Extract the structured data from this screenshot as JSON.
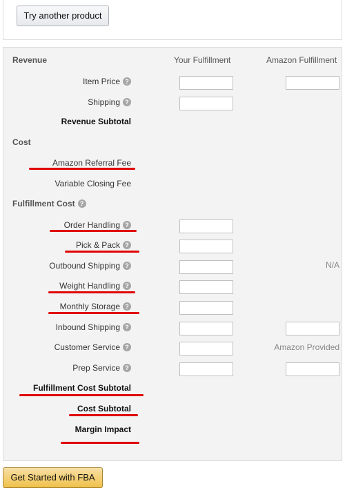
{
  "top": {
    "try_another_label": "Try another product"
  },
  "table": {
    "col_label": "Revenue",
    "col_your": "Your Fulfillment",
    "col_amazon": "Amazon Fulfillment",
    "help_glyph": "?"
  },
  "revenue": {
    "item_price": "Item Price",
    "shipping": "Shipping",
    "subtotal": "Revenue Subtotal"
  },
  "cost": {
    "section": "Cost",
    "referral_fee": "Amazon Referral Fee",
    "variable_closing_fee": "Variable Closing Fee"
  },
  "fulfillment": {
    "section": "Fulfillment Cost",
    "order_handling": "Order Handling",
    "pick_pack": "Pick & Pack",
    "outbound_shipping": "Outbound Shipping",
    "outbound_shipping_amazon": "N/A",
    "weight_handling": "Weight Handling",
    "monthly_storage": "Monthly Storage",
    "inbound_shipping": "Inbound Shipping",
    "customer_service": "Customer Service",
    "customer_service_amazon": "Amazon Provided",
    "prep_service": "Prep Service"
  },
  "totals": {
    "fulfillment_subtotal": "Fulfillment Cost Subtotal",
    "cost_subtotal": "Cost Subtotal",
    "margin_impact": "Margin Impact"
  },
  "footer": {
    "get_started_label": "Get Started with FBA"
  },
  "annotation": {
    "underline_color": "#e00000"
  }
}
